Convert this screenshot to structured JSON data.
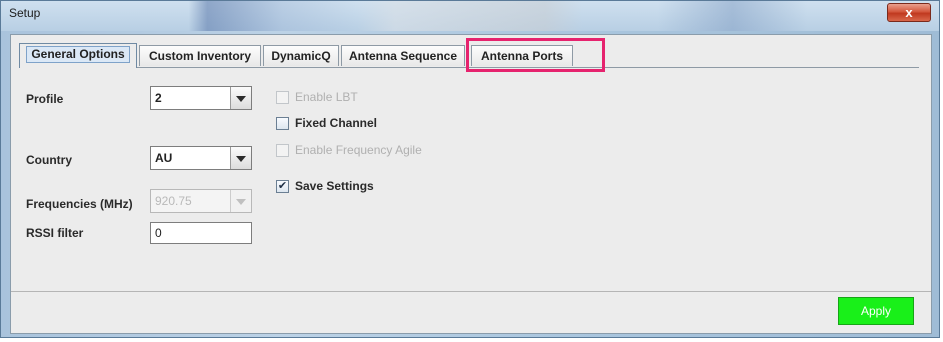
{
  "window": {
    "title": "Setup",
    "close_label": "x"
  },
  "tabs": [
    {
      "label": "General Options",
      "active": true
    },
    {
      "label": "Custom Inventory",
      "active": false
    },
    {
      "label": "DynamicQ",
      "active": false
    },
    {
      "label": "Antenna Sequence",
      "active": false
    },
    {
      "label": "Antenna Ports",
      "active": false,
      "highlighted": true
    }
  ],
  "form": {
    "profile": {
      "label": "Profile",
      "value": "2"
    },
    "country": {
      "label": "Country",
      "value": "AU"
    },
    "frequencies": {
      "label": "Frequencies (MHz)",
      "value": "920.75",
      "enabled": false
    },
    "rssi": {
      "label": "RSSI filter",
      "value": "0"
    }
  },
  "checkboxes": {
    "enable_lbt": {
      "label": "Enable LBT",
      "checked": false,
      "enabled": false
    },
    "fixed_channel": {
      "label": "Fixed Channel",
      "checked": false,
      "enabled": true
    },
    "enable_freq_agile": {
      "label": "Enable Frequency Agile",
      "checked": false,
      "enabled": false
    },
    "save_settings": {
      "label": "Save Settings",
      "checked": true,
      "enabled": true,
      "mark": "✔"
    }
  },
  "footer": {
    "apply_label": "Apply"
  },
  "colors": {
    "highlight": "#e6236e",
    "apply": "#19f019"
  }
}
